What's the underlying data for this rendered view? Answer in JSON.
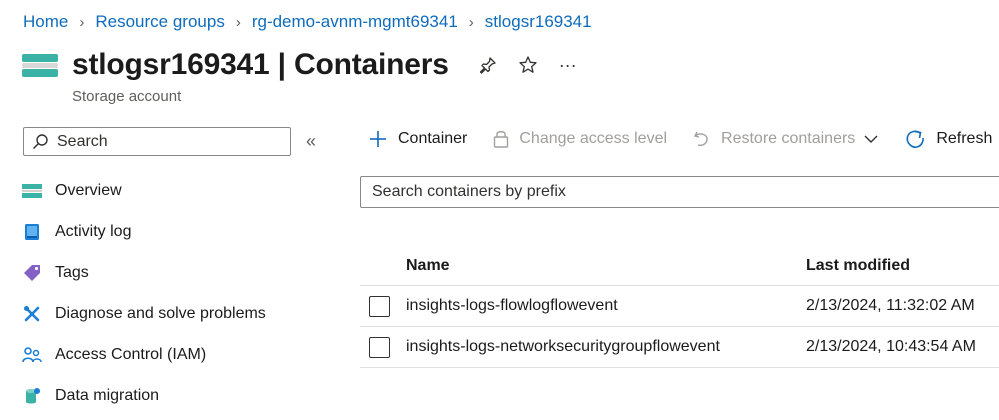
{
  "breadcrumb": {
    "items": [
      "Home",
      "Resource groups",
      "rg-demo-avnm-mgmt69341",
      "stlogsr169341"
    ]
  },
  "header": {
    "title": "stlogsr169341 | Containers",
    "subtitle": "Storage account",
    "actions": {
      "pin_icon": "pin-icon",
      "favorite_icon": "star-icon",
      "more": "···"
    }
  },
  "sidebar": {
    "search_placeholder": "Search",
    "collapse_glyph": "«",
    "items": [
      {
        "label": "Overview",
        "icon": "overview-icon"
      },
      {
        "label": "Activity log",
        "icon": "activity-log-icon"
      },
      {
        "label": "Tags",
        "icon": "tag-icon"
      },
      {
        "label": "Diagnose and solve problems",
        "icon": "wrench-icon"
      },
      {
        "label": "Access Control (IAM)",
        "icon": "people-icon"
      },
      {
        "label": "Data migration",
        "icon": "data-migration-icon"
      }
    ]
  },
  "toolbar": {
    "container_label": "Container",
    "change_access_label": "Change access level",
    "restore_label": "Restore containers",
    "refresh_label": "Refresh"
  },
  "main": {
    "search_placeholder": "Search containers by prefix",
    "table": {
      "columns": [
        "Name",
        "Last modified"
      ],
      "rows": [
        {
          "name": "insights-logs-flowlogflowevent",
          "modified": "2/13/2024, 11:32:02 AM"
        },
        {
          "name": "insights-logs-networksecuritygroupflowevent",
          "modified": "2/13/2024, 10:43:54 AM"
        }
      ]
    }
  },
  "colors": {
    "link": "#0f6cbd",
    "storage_top": "#3ab2a6",
    "storage_mid": "#d8d8d8",
    "storage_bottom": "#3ab2a6",
    "disabled": "#a19f9d",
    "accent": "#0f6cbd"
  }
}
